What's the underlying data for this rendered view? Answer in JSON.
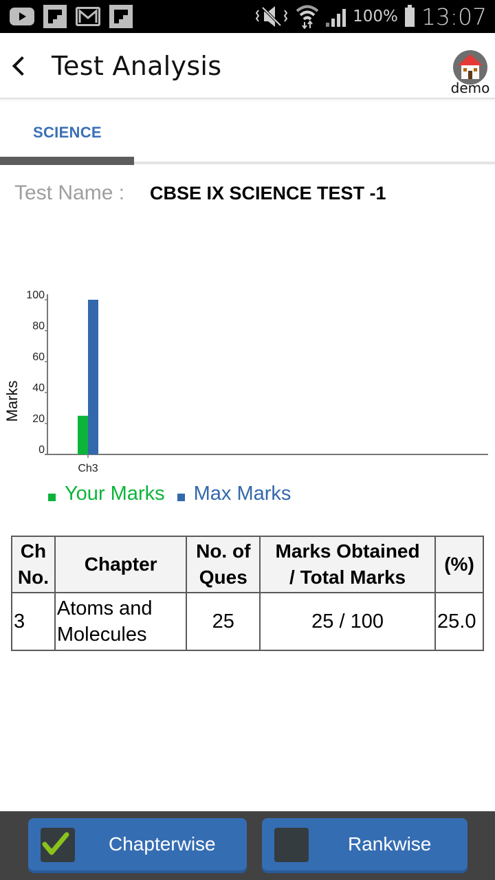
{
  "status_bar": {
    "left_icons": [
      "youtube-icon",
      "flipboard-icon",
      "gmail-icon",
      "flipboard-icon"
    ],
    "right_icons": [
      "mute-vibrate-icon",
      "wifi-icon",
      "signal-icon"
    ],
    "battery": "100%",
    "time": "13:07"
  },
  "app_bar": {
    "back_icon": "arrow-back-icon",
    "title": "Test Analysis",
    "profile_icon": "home-icon",
    "profile_label": "demo"
  },
  "tabs": [
    {
      "label": "SCIENCE",
      "selected": true
    }
  ],
  "test_info": {
    "label": "Test Name :",
    "value": "CBSE IX SCIENCE TEST -1"
  },
  "colors": {
    "your_marks": "#0cb43a",
    "max_marks": "#3468ac",
    "accent": "#3a6fb5"
  },
  "chart_data": {
    "type": "bar",
    "title": "",
    "xlabel": "",
    "ylabel": "Marks",
    "categories": [
      "Ch3"
    ],
    "series": [
      {
        "name": "Your Marks",
        "values": [
          25
        ]
      },
      {
        "name": "Max Marks",
        "values": [
          100
        ]
      }
    ],
    "ylim": [
      0,
      100
    ],
    "yticks": [
      0,
      20,
      40,
      60,
      80,
      100
    ],
    "grid": false,
    "legend": "bottom-left"
  },
  "table": {
    "headers": [
      "Ch No.",
      "Chapter",
      "No. of Ques",
      "Marks Obtained / Total Marks",
      "(%)"
    ],
    "rows": [
      {
        "ch_no": "3",
        "chapter": "Atoms and Molecules",
        "num_ques": "25",
        "marks": "25 / 100",
        "percent": "25.0"
      }
    ]
  },
  "bottom_buttons": [
    {
      "label": "Chapterwise",
      "checked": true
    },
    {
      "label": "Rankwise",
      "checked": false
    }
  ]
}
